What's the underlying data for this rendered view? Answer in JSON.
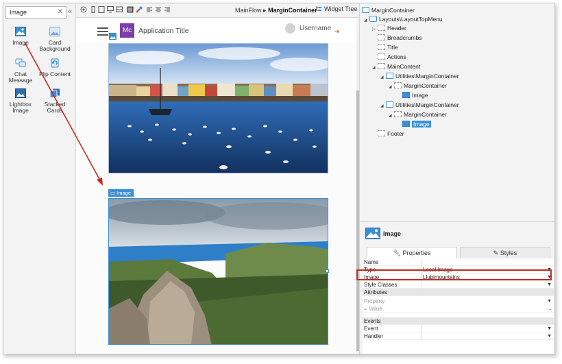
{
  "toolbox": {
    "search_value": "Image",
    "items": [
      {
        "label": "Image",
        "icon": "image-icon"
      },
      {
        "label": "Card Background",
        "icon": "card-background-icon"
      },
      {
        "label": "Chat Message",
        "icon": "chat-message-icon"
      },
      {
        "label": "Flip Content",
        "icon": "flip-content-icon"
      },
      {
        "label": "Lightbox Image",
        "icon": "lightbox-image-icon"
      },
      {
        "label": "Stacked Cards",
        "icon": "stacked-cards-icon"
      }
    ]
  },
  "toolbar": {
    "breadcrumb_flow": "MainFlow",
    "breadcrumb_sep": "▸",
    "breadcrumb_screen": "MarginContainer",
    "widget_tree_label": "Widget Tree"
  },
  "app_preview": {
    "logo_text": "Mc",
    "title": "Application Title",
    "username": "Username",
    "image_label": "Image"
  },
  "tree": {
    "root": "MarginContainer",
    "nodes": [
      {
        "label": "Layouts\\LayoutTopMenu"
      },
      {
        "label": "Header"
      },
      {
        "label": "Breadcrumbs"
      },
      {
        "label": "Title"
      },
      {
        "label": "Actions"
      },
      {
        "label": "MainContent"
      },
      {
        "label": "Utilities\\MarginContainer"
      },
      {
        "label": "MarginContainer"
      },
      {
        "label": "Image"
      },
      {
        "label": "Utilities\\MarginContainer"
      },
      {
        "label": "MarginContainer"
      },
      {
        "label": "Image"
      },
      {
        "label": "Footer"
      }
    ],
    "selected_index": 11
  },
  "properties": {
    "header_title": "Image",
    "tabs": [
      {
        "label": "Properties",
        "icon": "wrench-icon"
      },
      {
        "label": "Styles",
        "icon": "brush-icon"
      }
    ],
    "rows": [
      {
        "key": "Name",
        "value": ""
      },
      {
        "key": "Type",
        "value": "Local Image"
      },
      {
        "key": "Image",
        "value": "Llubimountains"
      },
      {
        "key": "Style Classes",
        "value": ""
      }
    ],
    "attributes_section": "Attributes",
    "attribute_property": "Property",
    "attribute_value": "= Value",
    "events_section": "Events",
    "event_rows": [
      {
        "key": "Event",
        "value": ""
      },
      {
        "key": "Handler",
        "value": ""
      }
    ]
  },
  "colors": {
    "accent": "#3a8fd6",
    "logo": "#7a3ea8",
    "annotation_red": "#c8291e"
  }
}
